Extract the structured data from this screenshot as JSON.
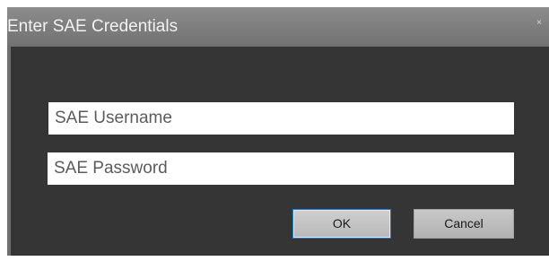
{
  "dialog": {
    "title": "Enter SAE Credentials",
    "close_glyph": "×",
    "close_icon": "close-icon"
  },
  "form": {
    "username_placeholder": "SAE Username",
    "username_value": "",
    "password_placeholder": "SAE Password",
    "password_value": ""
  },
  "buttons": {
    "ok_label": "OK",
    "cancel_label": "Cancel"
  },
  "colors": {
    "dialog_background": "#353535",
    "title_bar": "#7e7e7e",
    "focus_accent": "#1e7fd8"
  }
}
